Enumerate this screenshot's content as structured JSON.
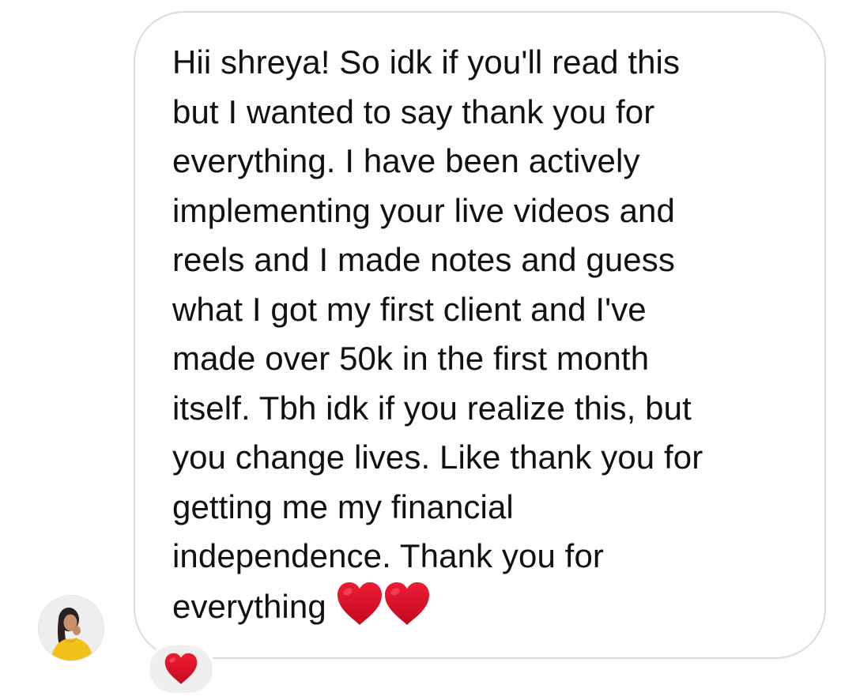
{
  "message": {
    "lines": [
      "Hii shreya! So idk if you'll read this",
      "but I wanted to say thank you for",
      "everything. I have been actively",
      "implementing your live videos and",
      "reels and I made notes and guess",
      "what I got my first client and I've",
      "made over 50k in the first month",
      "itself. Tbh idk if you realize this, but",
      "you change lives. Like thank you for",
      "getting me my financial",
      "independence. Thank you for",
      "everything"
    ],
    "trailing_emoji": [
      "red-heart",
      "red-heart"
    ]
  },
  "reaction": {
    "emoji": "red-heart"
  },
  "colors": {
    "bubble_border": "#dbdbdb",
    "text": "#111111",
    "heart_red": "#d3102a",
    "reaction_bg": "#efefef"
  }
}
